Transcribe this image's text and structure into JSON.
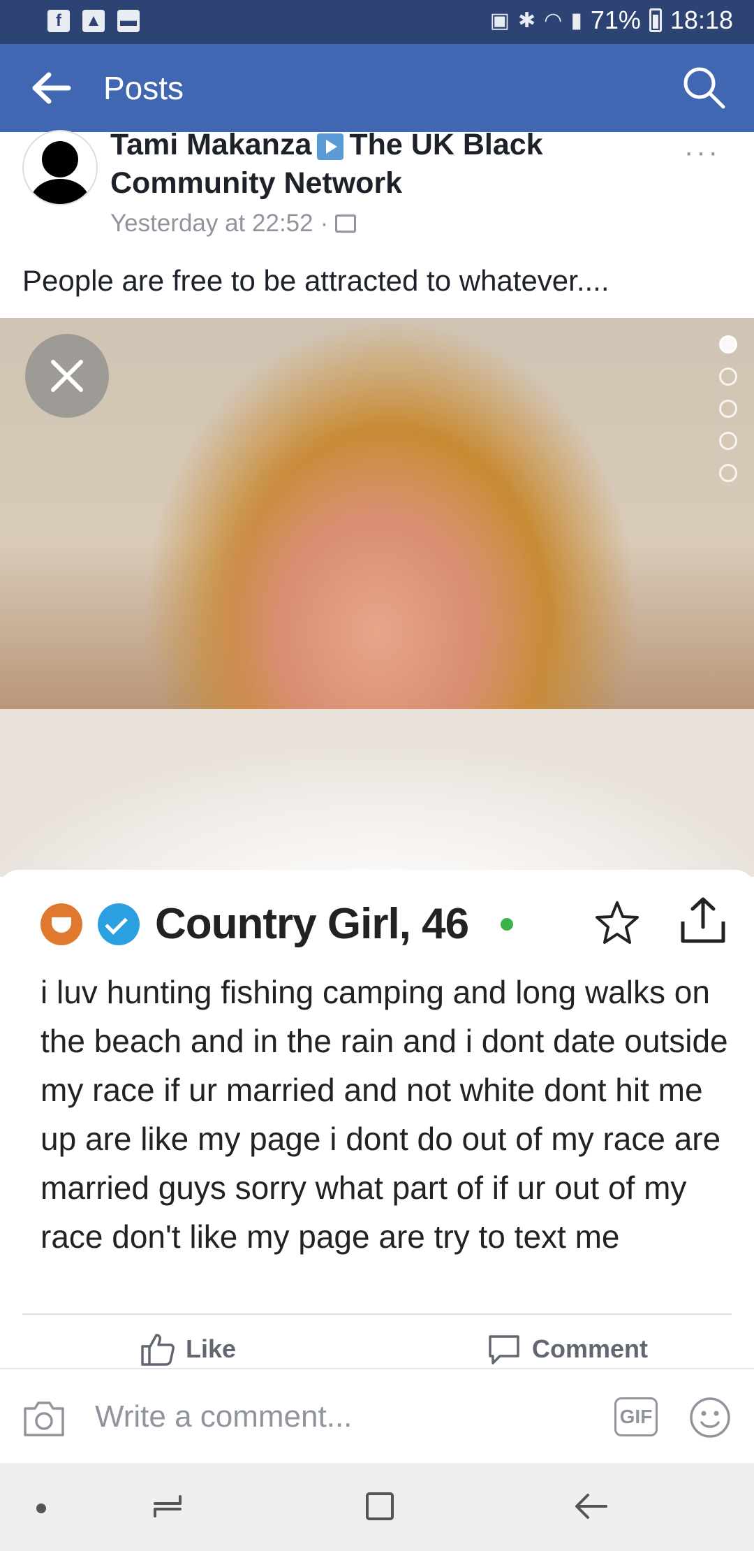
{
  "status_bar": {
    "battery": "71%",
    "time": "18:18"
  },
  "app_bar": {
    "title": "Posts"
  },
  "post": {
    "author": "Tami Makanza",
    "group": "The UK Black Community Network",
    "timestamp": "Yesterday at 22:52",
    "text": "People are free to be attracted to whatever....",
    "more": "···"
  },
  "profile_card": {
    "name": "Country Girl, 46",
    "bio": "i luv hunting fishing camping and long walks on the beach and in the rain and i dont date outside my race if ur married and not white dont hit me up are like my page i dont do out of my race are married guys sorry what part of if ur out of my race don't like my page are try to text me"
  },
  "actions": {
    "like": "Like",
    "comment": "Comment"
  },
  "comment_bar": {
    "placeholder": "Write a comment...",
    "gif": "GIF"
  },
  "colors": {
    "status_bar": "#2d4373",
    "app_bar": "#4267b2",
    "text_secondary": "#90949c"
  }
}
